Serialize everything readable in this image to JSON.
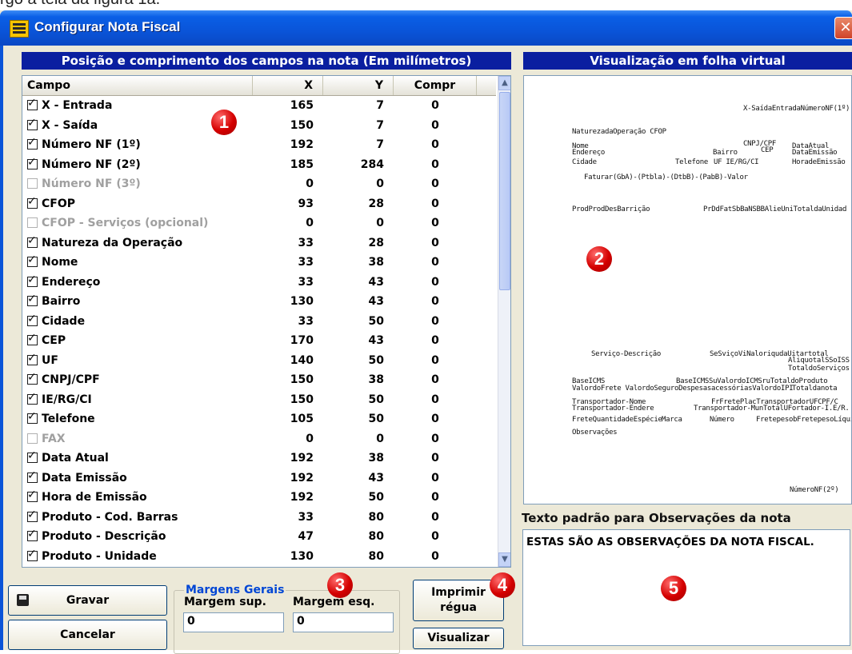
{
  "caption": "rgo à tela da figura 1a.",
  "window": {
    "title": "Configurar Nota Fiscal",
    "close_glyph": "✕"
  },
  "left_panel": {
    "header": "Posição e comprimento dos campos na nota (Em milímetros)",
    "columns": [
      "Campo",
      "X",
      "Y",
      "Compr"
    ],
    "rows": [
      {
        "name": "X - Entrada",
        "x": "165",
        "y": "7",
        "compr": "0",
        "checked": true
      },
      {
        "name": "X - Saída",
        "x": "150",
        "y": "7",
        "compr": "0",
        "checked": true
      },
      {
        "name": "Número NF (1º)",
        "x": "192",
        "y": "7",
        "compr": "0",
        "checked": true
      },
      {
        "name": "Número NF (2º)",
        "x": "185",
        "y": "284",
        "compr": "0",
        "checked": true
      },
      {
        "name": "Número NF (3º)",
        "x": "0",
        "y": "0",
        "compr": "0",
        "checked": false
      },
      {
        "name": "CFOP",
        "x": "93",
        "y": "28",
        "compr": "0",
        "checked": true
      },
      {
        "name": "CFOP - Serviços (opcional)",
        "x": "0",
        "y": "0",
        "compr": "0",
        "checked": false
      },
      {
        "name": "Natureza da Operação",
        "x": "33",
        "y": "28",
        "compr": "0",
        "checked": true
      },
      {
        "name": "Nome",
        "x": "33",
        "y": "38",
        "compr": "0",
        "checked": true
      },
      {
        "name": "Endereço",
        "x": "33",
        "y": "43",
        "compr": "0",
        "checked": true
      },
      {
        "name": "Bairro",
        "x": "130",
        "y": "43",
        "compr": "0",
        "checked": true
      },
      {
        "name": "Cidade",
        "x": "33",
        "y": "50",
        "compr": "0",
        "checked": true
      },
      {
        "name": "CEP",
        "x": "170",
        "y": "43",
        "compr": "0",
        "checked": true
      },
      {
        "name": "UF",
        "x": "140",
        "y": "50",
        "compr": "0",
        "checked": true
      },
      {
        "name": "CNPJ/CPF",
        "x": "150",
        "y": "38",
        "compr": "0",
        "checked": true
      },
      {
        "name": "IE/RG/CI",
        "x": "150",
        "y": "50",
        "compr": "0",
        "checked": true
      },
      {
        "name": "Telefone",
        "x": "105",
        "y": "50",
        "compr": "0",
        "checked": true
      },
      {
        "name": "FAX",
        "x": "0",
        "y": "0",
        "compr": "0",
        "checked": false
      },
      {
        "name": "Data Atual",
        "x": "192",
        "y": "38",
        "compr": "0",
        "checked": true
      },
      {
        "name": "Data Emissão",
        "x": "192",
        "y": "43",
        "compr": "0",
        "checked": true
      },
      {
        "name": "Hora de Emissão",
        "x": "192",
        "y": "50",
        "compr": "0",
        "checked": true
      },
      {
        "name": "Produto - Cod. Barras",
        "x": "33",
        "y": "80",
        "compr": "0",
        "checked": true
      },
      {
        "name": "Produto - Descrição",
        "x": "47",
        "y": "80",
        "compr": "0",
        "checked": true
      },
      {
        "name": "Produto - Unidade",
        "x": "130",
        "y": "80",
        "compr": "0",
        "checked": true
      }
    ]
  },
  "right_panel": {
    "header": "Visualização em folha virtual",
    "preview_texts": [
      "X-SaídaEntradaNúmeroNF(1º)",
      "NaturezadaOperação CFOP",
      "Nome",
      "CNPJ/CPF",
      "DataAtual",
      "Endereço",
      "Bairro",
      "CEP",
      "DataEmissão",
      "Cidade",
      "Telefone",
      "UF IE/RG/CI",
      "HoradeEmissão",
      "Faturar(GbA)-(Ptbla)-(DtbB)-(PabB)-Valor",
      "ProdProdDesBarrição",
      "PrDdFatSbBaNSBBAlieUniTotaldaUnidad",
      "Serviço-Descrição",
      "SeSviçoViNaloriqudaUitartotal",
      "AliquotalSSoISS",
      "TotaldoServiços",
      "BaseICMS",
      "BaseICMSSuValordoICMSruTotaldoProduto",
      "ValordoFrete ValordoSeguroDespesasacessóriasValordoIPI",
      "Totaldanota",
      "Transportador-Nome",
      "FrFretePlacTransportadorUFCPF/C",
      "Transportador-Endere",
      "Transportador-MunTotalUFortador-I.E/R.",
      "FreteQuantidadeEspécie",
      "Marca",
      "Número",
      "FretepesobFretepesoLíquido",
      "Observações",
      "NúmeroNF(2º)"
    ]
  },
  "observacoes": {
    "label": "Texto padrão para Observações da nota",
    "value": "ESTAS SÃO AS OBSERVAÇÕES DA NOTA FISCAL."
  },
  "buttons": {
    "gravar": "Gravar",
    "cancelar": "Cancelar",
    "imprimir_line1": "Imprimir",
    "imprimir_line2": "régua",
    "visualizar": "Visualizar"
  },
  "margens": {
    "legend": "Margens Gerais",
    "sup_label": "Margem sup.",
    "sup_value": "0",
    "esq_label": "Margem esq.",
    "esq_value": "0"
  },
  "markers": [
    "1",
    "2",
    "3",
    "4",
    "5"
  ],
  "colors": {
    "header_blue": "#0a1fa0",
    "marker_red": "#d40000",
    "title_blue": "#0a54d8"
  }
}
